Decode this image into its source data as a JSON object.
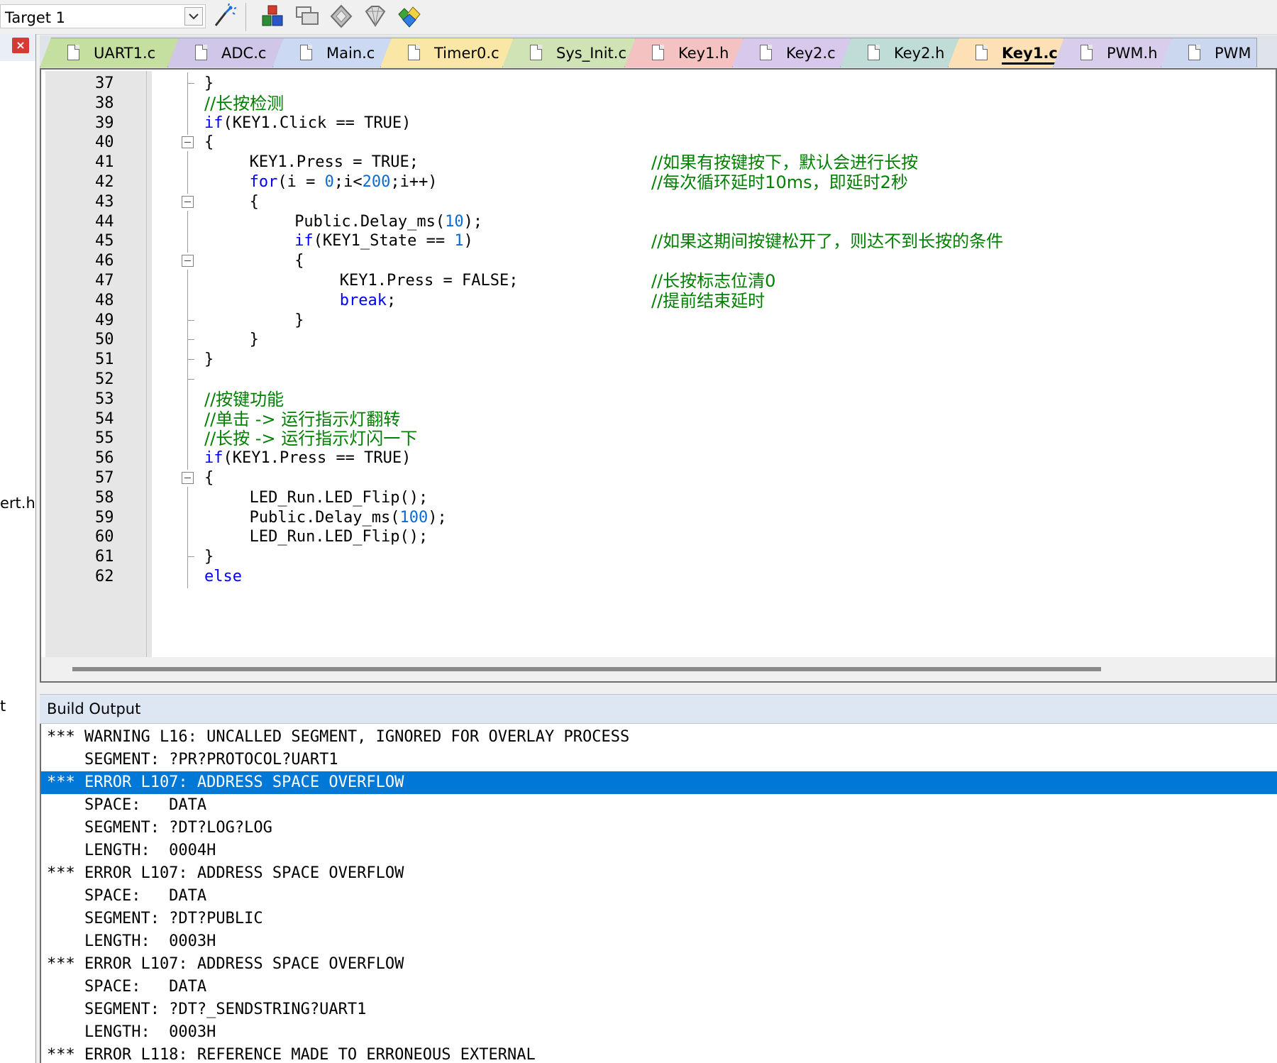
{
  "toolbar": {
    "target": "Target 1",
    "icons": [
      "dropdown-chevron-icon",
      "magic-wand-icon",
      "component-manager-icon",
      "copy-window-icon",
      "diamond-icon",
      "gem-icon",
      "multi-gem-icon"
    ]
  },
  "left_panel": {
    "fragments": [
      "ert.h",
      "t"
    ]
  },
  "tabs": [
    {
      "label": "UART1.c",
      "color": "#c5dfa0"
    },
    {
      "label": "ADC.c",
      "color": "#cfc6e8"
    },
    {
      "label": "Main.c",
      "color": "#cbd9f2"
    },
    {
      "label": "Timer0.c",
      "color": "#fae7a6"
    },
    {
      "label": "Sys_Init.c",
      "color": "#cfe3b5"
    },
    {
      "label": "Key1.h",
      "color": "#f5c2c2"
    },
    {
      "label": "Key2.c",
      "color": "#d7c8ec"
    },
    {
      "label": "Key2.h",
      "color": "#bfdcd7"
    },
    {
      "label": "Key1.c",
      "color": "#fde0b5",
      "active": true
    },
    {
      "label": "PWM.h",
      "color": "#d8cdea"
    },
    {
      "label": "PWM",
      "color": "#cbd6ef"
    }
  ],
  "code_lines": [
    {
      "n": "37",
      "fold": "tick",
      "code": "}",
      "indent": 1
    },
    {
      "n": "38",
      "fold": "line",
      "comment_only": "//长按检测",
      "indent": 1
    },
    {
      "n": "39",
      "fold": "line",
      "kw": "if",
      "code": "(KEY1.Click == TRUE)",
      "indent": 1
    },
    {
      "n": "40",
      "fold": "box",
      "code": "{",
      "indent": 1
    },
    {
      "n": "41",
      "fold": "line",
      "code": "KEY1.Press = TRUE;",
      "comment": "//如果有按键按下，默认会进行长按",
      "indent": 2
    },
    {
      "n": "42",
      "fold": "line",
      "kw": "for",
      "code": "(i = ",
      "num": "0",
      "code2": ";i<",
      "num2": "200",
      "code3": ";i++)",
      "comment": "//每次循环延时10ms，即延时2秒",
      "indent": 2
    },
    {
      "n": "43",
      "fold": "box",
      "code": "{",
      "indent": 2
    },
    {
      "n": "44",
      "fold": "line",
      "code": "Public.Delay_ms(",
      "num": "10",
      "code2": ");",
      "indent": 3
    },
    {
      "n": "45",
      "fold": "line",
      "kw": "if",
      "code": "(KEY1_State == ",
      "num": "1",
      "code2": ")",
      "comment": "//如果这期间按键松开了，则达不到长按的条件",
      "indent": 3
    },
    {
      "n": "46",
      "fold": "box",
      "code": "{",
      "indent": 3
    },
    {
      "n": "47",
      "fold": "line",
      "code": "KEY1.Press = FALSE;",
      "comment": "//长按标志位清0",
      "indent": 4
    },
    {
      "n": "48",
      "fold": "line",
      "kw": "break",
      "code": ";",
      "comment": "//提前结束延时",
      "indent": 4
    },
    {
      "n": "49",
      "fold": "tick",
      "code": "}",
      "indent": 3
    },
    {
      "n": "50",
      "fold": "tick",
      "code": "}",
      "indent": 2
    },
    {
      "n": "51",
      "fold": "tick",
      "code": "}",
      "indent": 1
    },
    {
      "n": "52",
      "fold": "tick",
      "code": "",
      "indent": 1
    },
    {
      "n": "53",
      "fold": "line",
      "comment_only": "//按键功能",
      "indent": 1
    },
    {
      "n": "54",
      "fold": "line",
      "comment_only": "//单击 -> 运行指示灯翻转",
      "indent": 1
    },
    {
      "n": "55",
      "fold": "line",
      "comment_only": "//长按 -> 运行指示灯闪一下",
      "indent": 1
    },
    {
      "n": "56",
      "fold": "line",
      "kw": "if",
      "code": "(KEY1.Press == TRUE)",
      "indent": 1
    },
    {
      "n": "57",
      "fold": "box",
      "code": "{",
      "indent": 1
    },
    {
      "n": "58",
      "fold": "line",
      "code": "LED_Run.LED_Flip();",
      "indent": 2
    },
    {
      "n": "59",
      "fold": "line",
      "code": "Public.Delay_ms(",
      "num": "100",
      "code2": ");",
      "indent": 2
    },
    {
      "n": "60",
      "fold": "line",
      "code": "LED_Run.LED_Flip();",
      "indent": 2
    },
    {
      "n": "61",
      "fold": "tick",
      "code": "}",
      "indent": 1
    },
    {
      "n": "62",
      "fold": "line",
      "kw": "else",
      "code": "",
      "indent": 1
    }
  ],
  "build": {
    "title": "Build Output",
    "lines": [
      {
        "text": "*** WARNING L16: UNCALLED SEGMENT, IGNORED FOR OVERLAY PROCESS"
      },
      {
        "text": "    SEGMENT: ?PR?PROTOCOL?UART1"
      },
      {
        "text": "*** ERROR L107: ADDRESS SPACE OVERFLOW",
        "selected": true
      },
      {
        "text": "    SPACE:   DATA"
      },
      {
        "text": "    SEGMENT: ?DT?LOG?LOG"
      },
      {
        "text": "    LENGTH:  0004H"
      },
      {
        "text": "*** ERROR L107: ADDRESS SPACE OVERFLOW"
      },
      {
        "text": "    SPACE:   DATA"
      },
      {
        "text": "    SEGMENT: ?DT?PUBLIC"
      },
      {
        "text": "    LENGTH:  0003H"
      },
      {
        "text": "*** ERROR L107: ADDRESS SPACE OVERFLOW"
      },
      {
        "text": "    SPACE:   DATA"
      },
      {
        "text": "    SEGMENT: ?DT?_SENDSTRING?UART1"
      },
      {
        "text": "    LENGTH:  0003H"
      },
      {
        "text": "*** ERROR L118: REFERENCE MADE TO ERRONEOUS EXTERNAL"
      }
    ]
  },
  "colors": {
    "keyword": "#0000ff",
    "comment": "#008000",
    "number": "#0a6bd3",
    "selection": "#0078d7"
  }
}
